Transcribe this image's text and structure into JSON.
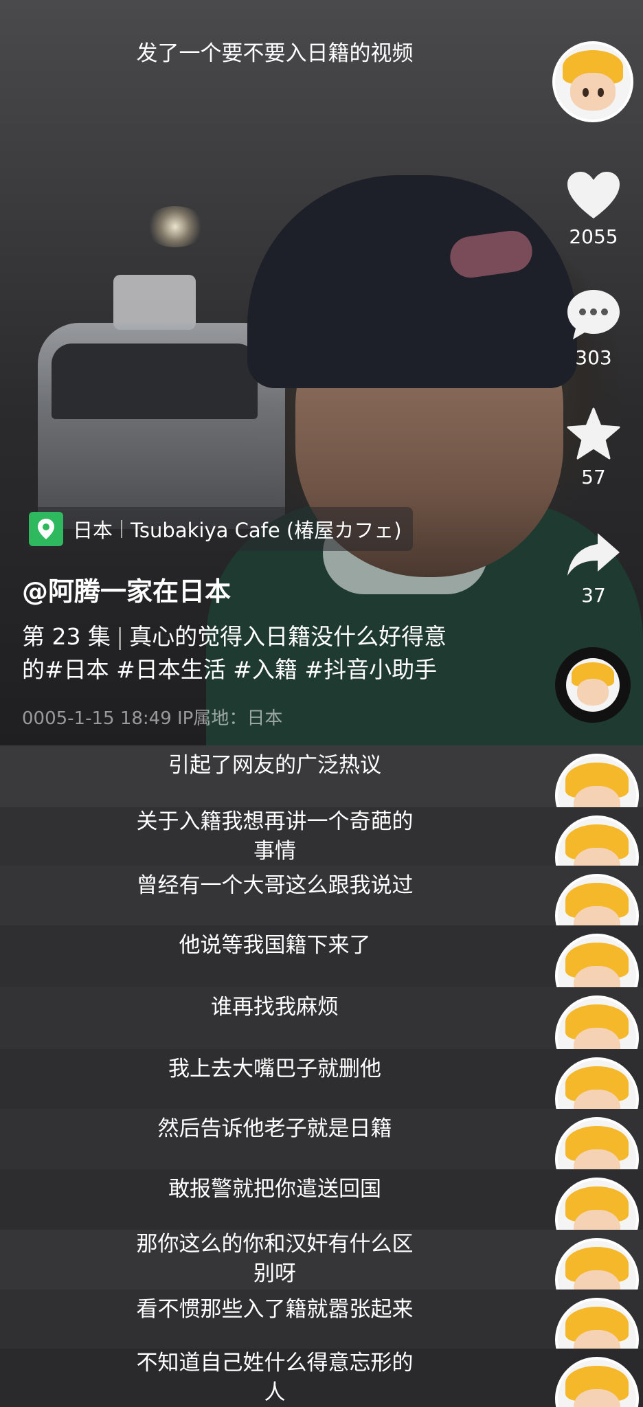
{
  "video": {
    "top_title": "发了一个要不要入日籍的视频",
    "actions": {
      "likes": "2055",
      "comments": "303",
      "favorites": "57",
      "shares": "37"
    },
    "location": {
      "region": "日本",
      "place": "Tsubakiya Cafe (椿屋カフェ)"
    },
    "author": "@阿腾一家在日本",
    "description": {
      "episode": "第 23 集",
      "text_line1": "真心的觉得入日籍没什么好得意",
      "text_line2": "的#日本 #日本生活 #入籍 #抖音小助手"
    },
    "meta": "0005-1-15 18:49  IP属地：日本"
  },
  "subtitles": [
    {
      "line1": "引起了网友的广泛热议",
      "line2": ""
    },
    {
      "line1": "关于入籍我想再讲一个奇葩的",
      "line2": "事情"
    },
    {
      "line1": "曾经有一个大哥这么跟我说过",
      "line2": ""
    },
    {
      "line1": "他说等我国籍下来了",
      "line2": ""
    },
    {
      "line1": "谁再找我麻烦",
      "line2": ""
    },
    {
      "line1": "我上去大嘴巴子就删他",
      "line2": ""
    },
    {
      "line1": "然后告诉他老子就是日籍",
      "line2": ""
    },
    {
      "line1": "敢报警就把你遣送回国",
      "line2": ""
    },
    {
      "line1": "那你这么的你和汉奸有什么区",
      "line2": "别呀"
    },
    {
      "line1": "看不惯那些入了籍就嚣张起来",
      "line2": ""
    },
    {
      "line1": "不知道自己姓什么得意忘形的",
      "line2": "人"
    }
  ]
}
